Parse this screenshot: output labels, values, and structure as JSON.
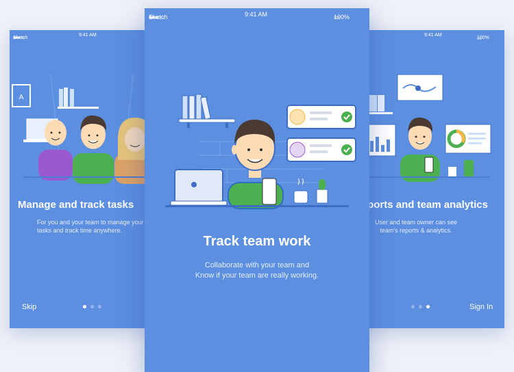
{
  "status": {
    "carrier": "Sketch",
    "time": "9:41 AM",
    "battery": "100%"
  },
  "screens": [
    {
      "title": "Manage and track tasks",
      "subtitle": "For you and your team to manage your\ntasks and track time anywhere.",
      "skip_label": "Skip",
      "page": 1,
      "pages": 3
    },
    {
      "title": "Track team work",
      "subtitle": "Collaborate with your team and\nKnow if your team are really working.",
      "page": 2,
      "pages": 3
    },
    {
      "title": "Reports and team analytics",
      "subtitle": "User and team owner can see\nteam's reports & analytics.",
      "signin_label": "Sign In",
      "page": 3,
      "pages": 3
    }
  ],
  "colors": {
    "accent": "#5c8fe0",
    "accent_dark": "#3e6cc4",
    "green": "#4caf50",
    "skin": "#fddcb5"
  }
}
